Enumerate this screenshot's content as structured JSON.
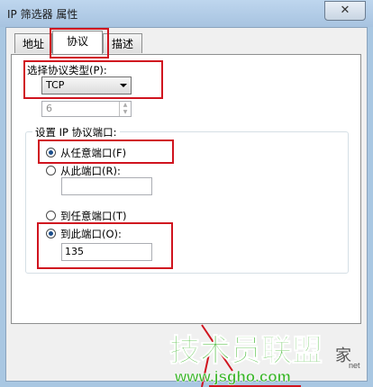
{
  "window": {
    "title": "IP 筛选器 属性",
    "close_glyph": "✕"
  },
  "tabs": [
    {
      "label": "地址"
    },
    {
      "label": "协议"
    },
    {
      "label": "描述"
    }
  ],
  "protocol": {
    "type_label": "选择协议类型(P):",
    "type_value": "TCP",
    "number_value": "6"
  },
  "ports": {
    "group_title": "设置 IP 协议端口:",
    "from_any_label": "从任意端口(F)",
    "from_port_label": "从此端口(R):",
    "from_port_value": "",
    "to_any_label": "到任意端口(T)",
    "to_port_label": "到此端口(O):",
    "to_port_value": "135"
  },
  "watermark": {
    "brand": "技术员联盟",
    "url": "www.jsgho.com",
    "tail": "家",
    "net": "net"
  },
  "colors": {
    "highlight": "#d0141f",
    "watermark_green": "#3bb52a"
  }
}
